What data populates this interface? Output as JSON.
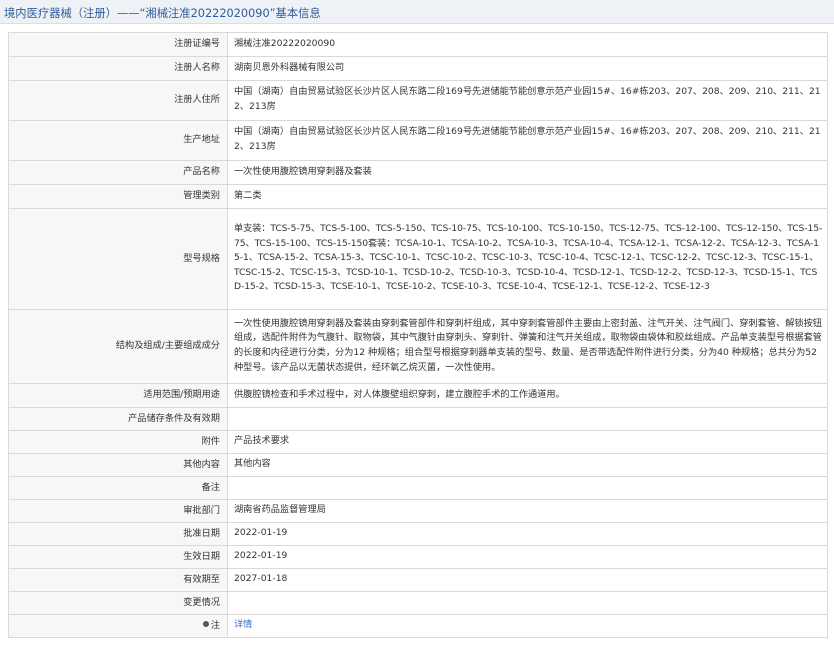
{
  "header": {
    "title": "境内医疗器械（注册）——“湘械注准20222020090”基本信息"
  },
  "rows": [
    {
      "label": "注册证编号",
      "value": "湘械注准20222020090"
    },
    {
      "label": "注册人名称",
      "value": "湖南贝恩外科器械有限公司"
    },
    {
      "label": "注册人住所",
      "value": "中国（湖南）自由贸易试验区长沙片区人民东路二段169号先进储能节能创意示范产业园15#、16#栋203、207、208、209、210、211、212、213房"
    },
    {
      "label": "生产地址",
      "value": "中国（湖南）自由贸易试验区长沙片区人民东路二段169号先进储能节能创意示范产业园15#、16#栋203、207、208、209、210、211、212、213房"
    },
    {
      "label": "产品名称",
      "value": "一次性使用腹腔镜用穿刺器及套装"
    },
    {
      "label": "管理类别",
      "value": "第二类"
    },
    {
      "label": "型号规格",
      "value": "单支装：TCS-5-75、TCS-5-100、TCS-5-150、TCS-10-75、TCS-10-100、TCS-10-150、TCS-12-75、TCS-12-100、TCS-12-150、TCS-15-75、TCS-15-100、TCS-15-150套装：TCSA-10-1、TCSA-10-2、TCSA-10-3、TCSA-10-4、TCSA-12-1、TCSA-12-2、TCSA-12-3、TCSA-15-1、TCSA-15-2、TCSA-15-3、TCSC-10-1、TCSC-10-2、TCSC-10-3、TCSC-10-4、TCSC-12-1、TCSC-12-2、TCSC-12-3、TCSC-15-1、TCSC-15-2、TCSC-15-3、TCSD-10-1、TCSD-10-2、TCSD-10-3、TCSD-10-4、TCSD-12-1、TCSD-12-2、TCSD-12-3、TCSD-15-1、TCSD-15-2、TCSD-15-3、TCSE-10-1、TCSE-10-2、TCSE-10-3、TCSE-10-4、TCSE-12-1、TCSE-12-2、TCSE-12-3"
    },
    {
      "label": "结构及组成/主要组成成分",
      "value": "一次性使用腹腔镜用穿刺器及套装由穿刺套管部件和穿刺杆组成，其中穿刺套管部件主要由上密封盖、注气开关、注气阀门、穿刺套管、解锁按钮组成，选配件附件为气腹针、取物袋，其中气腹针由穿刺头、穿刺针、弹簧和注气开关组成，取物袋由袋体和胶丝组成。产品单支装型号根据套管的长度和内径进行分类，分为12 种规格；组合型号根据穿刺器单支装的型号、数量、是否带选配件附件进行分类，分为40 种规格；总共分为52 种型号。该产品以无菌状态提供，经环氧乙烷灭菌，一次性使用。"
    },
    {
      "label": "适用范围/预期用途",
      "value": "供腹腔镜检查和手术过程中，对人体腹壁组织穿刺，建立腹腔手术的工作通道用。"
    },
    {
      "label": "产品储存条件及有效期",
      "value": ""
    },
    {
      "label": "附件",
      "value": "产品技术要求"
    },
    {
      "label": "其他内容",
      "value": "其他内容"
    },
    {
      "label": "备注",
      "value": ""
    },
    {
      "label": "审批部门",
      "value": "湖南省药品监督管理局"
    },
    {
      "label": "批准日期",
      "value": "2022-01-19"
    },
    {
      "label": "生效日期",
      "value": "2022-01-19"
    },
    {
      "label": "有效期至",
      "value": "2027-01-18"
    },
    {
      "label": "变更情况",
      "value": ""
    }
  ],
  "footer": {
    "label": "注",
    "link": "详情"
  }
}
